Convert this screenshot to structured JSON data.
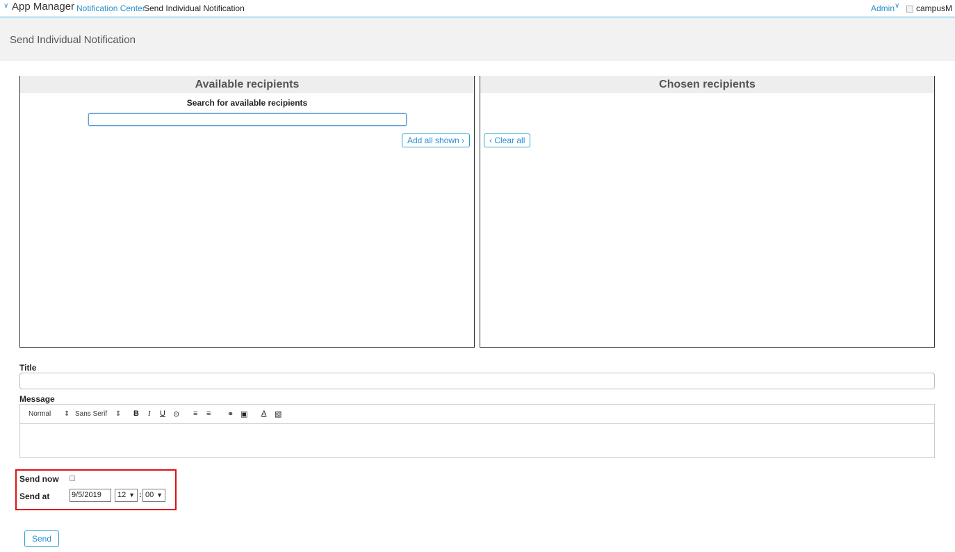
{
  "nav": {
    "app_title": "App Manager",
    "breadcrumb_parent": "Notification Center",
    "breadcrumb_current": "Send Individual Notification",
    "user_menu": "Admin",
    "logo_alt": "campusM"
  },
  "page": {
    "title": "Send Individual Notification"
  },
  "recipients": {
    "available_heading": "Available recipients",
    "search_label": "Search for available recipients",
    "search_value": "",
    "add_all_label": "Add all shown",
    "chosen_heading": "Chosen recipients",
    "clear_all_label": "Clear all"
  },
  "form": {
    "title_label": "Title",
    "title_value": "",
    "message_label": "Message",
    "toolbar": {
      "paragraph_format": "Normal",
      "font": "Sans Serif",
      "bold": "B",
      "italic": "I",
      "underline": "U"
    },
    "send_now_label": "Send now",
    "send_now_checked": false,
    "send_at_label": "Send at",
    "send_at_date": "9/5/2019",
    "send_at_hour": "12",
    "send_at_minute": "00",
    "send_label": "Send"
  },
  "colors": {
    "accent": "#2a8fd0",
    "highlight": "#e01010"
  },
  "icons": [
    "chevron-down-icon",
    "broken-image-icon",
    "chevron-right-icon",
    "chevron-left-icon",
    "updown-arrows-icon",
    "strike-icon",
    "ordered-list-icon",
    "bullet-list-icon",
    "link-icon",
    "image-icon",
    "text-color-icon",
    "clear-format-icon",
    "dropdown-arrow-icon"
  ]
}
